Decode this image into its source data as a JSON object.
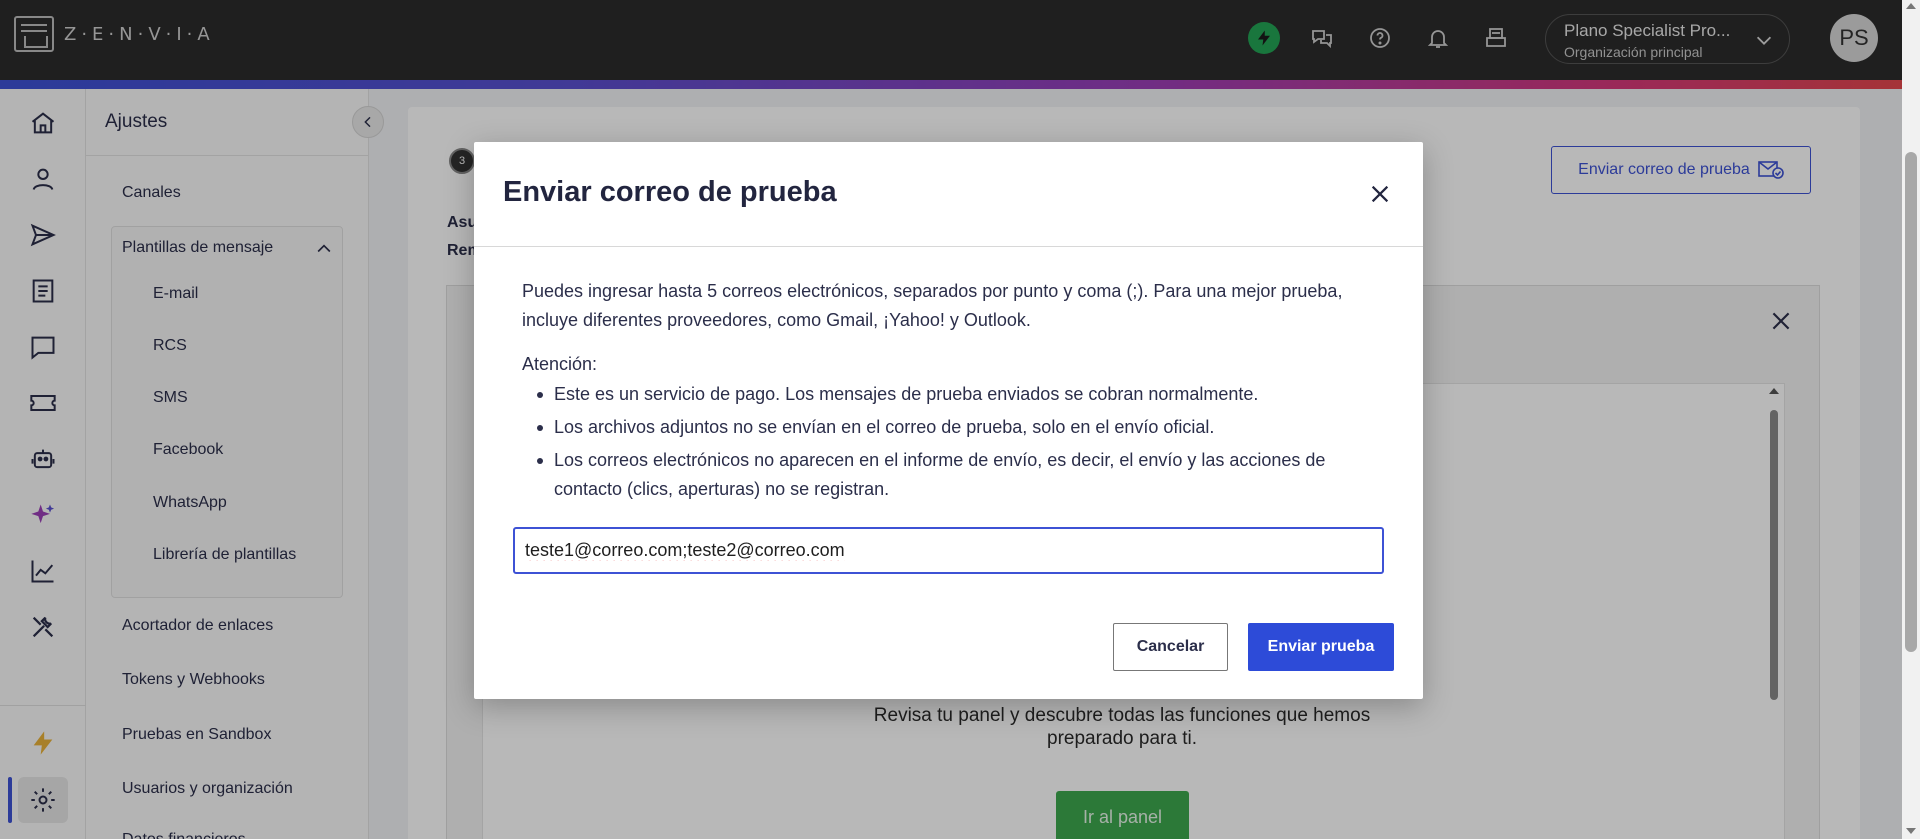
{
  "app": {
    "logo_text": "Z·E·N·V·I·A"
  },
  "header": {
    "org_name": "Plano Specialist Pro...",
    "org_subtitle": "Organización principal",
    "avatar_initials": "PS",
    "icons": [
      "bolt-icon",
      "chat-bubbles-icon",
      "help-icon",
      "bell-icon",
      "inbox-tray-icon"
    ],
    "bolt_color": "#23a455"
  },
  "rail": {
    "icons": [
      "home-icon",
      "user-icon",
      "send-icon",
      "document-icon",
      "chat-icon",
      "ticket-icon",
      "bot-icon",
      "sparkle-icon",
      "chart-icon",
      "tools-icon",
      "bolt-icon",
      "gear-icon"
    ],
    "active": "gear-icon",
    "accent_color": "#3d52d5"
  },
  "sidebar": {
    "title": "Ajustes",
    "canales": "Canales",
    "plantillas": "Plantillas de mensaje",
    "sub_items": [
      "E-mail",
      "RCS",
      "SMS",
      "Facebook",
      "WhatsApp",
      "Librería de plantillas"
    ],
    "acortador": "Acortador de enlaces",
    "tokens": "Tokens y Webhooks",
    "sandbox": "Pruebas en Sandbox",
    "usuarios": "Usuarios y organización",
    "cut_item": "Datos financieros"
  },
  "background": {
    "step": "3",
    "frag_asunto": "Asu",
    "frag_remitente": "Rem",
    "send_test_button": "Enviar correo de prueba",
    "preview_text": "Revisa tu panel y descubre todas las funciones que hemos preparado para ti.",
    "preview_button": "Ir al panel"
  },
  "modal": {
    "title": "Enviar correo de prueba",
    "description": "Puedes ingresar hasta 5 correos electrónicos, separados por punto y coma (;). Para una mejor prueba, incluye diferentes proveedores, como Gmail, ¡Yahoo! y Outlook.",
    "attention_label": "Atención:",
    "bullets": [
      "Este es un servicio de pago. Los mensajes de prueba enviados se cobran normalmente.",
      "Los archivos adjuntos no se envían en el correo de prueba, solo en el envío oficial.",
      "Los correos electrónicos no aparecen en el informe de envío, es decir, el envío y las acciones de contacto (clics, aperturas) no se registran."
    ],
    "email_value": "teste1@correo.com;teste2@correo.com",
    "cancel_label": "Cancelar",
    "send_label": "Enviar prueba",
    "primary_color": "#2d4bd8"
  }
}
